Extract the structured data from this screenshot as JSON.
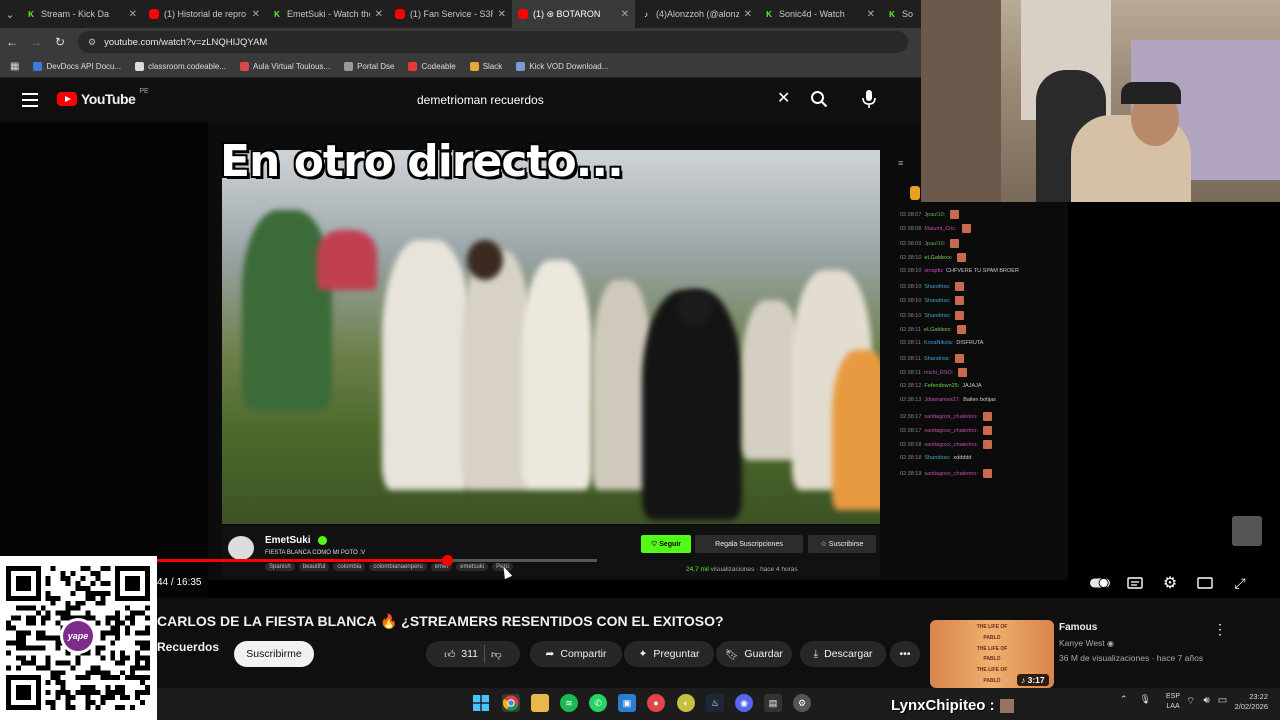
{
  "browser": {
    "tabs": [
      {
        "label": "Stream - Kick Da",
        "icon": "kick-icon",
        "active": false
      },
      {
        "label": "(1) Historial de repro",
        "icon": "youtube-icon",
        "active": false
      },
      {
        "label": "EmetSuki - Watch the",
        "icon": "kick-icon",
        "active": false
      },
      {
        "label": "(1) Fan Service - S3RL",
        "icon": "youtube-icon",
        "active": false
      },
      {
        "label": "(1) ⊛ BOTARON",
        "icon": "youtube-icon",
        "active": true
      },
      {
        "label": "(4)Alonzzoh (@alonz",
        "icon": "tiktok-icon",
        "active": false
      },
      {
        "label": "Sonic4d - Watch",
        "icon": "kick-icon",
        "active": false
      },
      {
        "label": "So",
        "icon": "kick-icon",
        "active": false
      }
    ],
    "url": "youtube.com/watch?v=zLNQHIJQYAM",
    "bookmarks": [
      {
        "label": "DevDocs API Docu...",
        "color": "#3a7bd5"
      },
      {
        "label": "classroom.codeable...",
        "color": "#dddddd"
      },
      {
        "label": "Aula Virtual Toulous...",
        "color": "#d84a4a"
      },
      {
        "label": "Portal Dse",
        "color": "#999999"
      },
      {
        "label": "Codeable",
        "color": "#e53935"
      },
      {
        "label": "Slack",
        "color": "#e8a53a"
      },
      {
        "label": "Kick VOD Download...",
        "color": "#7a9cd6"
      }
    ]
  },
  "youtube": {
    "logo": "YouTube",
    "region": "PE",
    "search_query": "demetrioman recuerdos"
  },
  "video": {
    "caption": "En otro directo...",
    "stream": {
      "streamer": "EmetSuki",
      "title": "FIESTA BLANCA COMO MI POTO :V",
      "follow_label": "♡ Seguir",
      "gift_label": "Regala Suscripciones",
      "subscribe_label": "☆ Suscribirse",
      "tags": [
        "Spanish",
        "beautiful",
        "colombia",
        "colombianaenperu",
        "emet",
        "emetsuki",
        "Perú"
      ],
      "views_count": "24,7 mil",
      "views_rest": " visualizaciones · hace 4 horas"
    },
    "chat": [
      {
        "time": "02:38:07",
        "user": "Jpaul10:",
        "color": "#6aa84f",
        "text": "",
        "emote": true
      },
      {
        "time": "02:38:08",
        "user": "Maiumi_Cric:",
        "color": "#c64fb0",
        "text": "",
        "emote": true
      },
      {
        "time": "02:38:09",
        "user": "Jpaul10:",
        "color": "#6aa84f",
        "text": "",
        "emote": true
      },
      {
        "time": "02:38:10",
        "user": "eLGablexx:",
        "color": "#7ec850",
        "text": "",
        "emote": true
      },
      {
        "time": "02:38:10",
        "user": "sinaptiz",
        "color": "#c64fb0",
        "text": "CHFVERE TU SPAM BROER",
        "emote": false
      },
      {
        "time": "02:38:10",
        "user": "Shandriss:",
        "color": "#3da5d9",
        "text": "",
        "emote": true
      },
      {
        "time": "02:38:10",
        "user": "Shandriss:",
        "color": "#3da5d9",
        "text": "",
        "emote": true
      },
      {
        "time": "02:38:10",
        "user": "Shandriss:",
        "color": "#3da5d9",
        "text": "",
        "emote": true
      },
      {
        "time": "02:38:11",
        "user": "eLGablexx:",
        "color": "#7ec850",
        "text": "",
        "emote": true
      },
      {
        "time": "02:38:11",
        "user": "KovaNikola:",
        "color": "#3da5d9",
        "text": "DISFRUTA",
        "emote": false
      },
      {
        "time": "02:38:11",
        "user": "Shandriss:",
        "color": "#3da5d9",
        "text": "",
        "emote": true
      },
      {
        "time": "02:38:11",
        "user": "michi_RSO:",
        "color": "#c64fb0",
        "text": "",
        "emote": true
      },
      {
        "time": "02:38:12",
        "user": "Fefendown25:",
        "color": "#7ec850",
        "text": "JAJAJA",
        "emote": false
      },
      {
        "time": "02:38:13",
        "user": "Jdiamantes27:",
        "color": "#c64fb0",
        "text": "Bailen botijas",
        "emote": false
      },
      {
        "time": "02:38:17",
        "user": "santiagoxx_chaterino:",
        "color": "#c64fb0",
        "text": "",
        "emote": true
      },
      {
        "time": "02:38:17",
        "user": "santiagoxx_chaterino:",
        "color": "#c64fb0",
        "text": "",
        "emote": true
      },
      {
        "time": "02:38:18",
        "user": "santiagoxx_chaterino:",
        "color": "#c64fb0",
        "text": "",
        "emote": true
      },
      {
        "time": "02:38:18",
        "user": "Shandriss:",
        "color": "#3da5d9",
        "text": "xddddd",
        "emote": false
      },
      {
        "time": "02:38:19",
        "user": "santiagoxx_chaterino:",
        "color": "#c64fb0",
        "text": "",
        "emote": true
      }
    ],
    "time_current": "44",
    "time_total": "16:35",
    "progress": 0.659
  },
  "details": {
    "title": "CARLOS DE LA FIESTA BLANCA 🔥 ¿STREAMERS RESENTIDOS CON EL EXITOSO?",
    "channel": "Recuerdos",
    "subscribe_label": "Suscribirme",
    "likes": "311",
    "share_label": "Compartir",
    "ask_label": "Preguntar",
    "save_label": "Guardar",
    "download_label": "Descargar"
  },
  "recommended": {
    "title": "Famous",
    "channel": "Kanye West",
    "meta": "36 M de visualizaciones · hace 7 años",
    "duration": "3:17",
    "thumb_lines": [
      "THE LIFE OF",
      "PABLO",
      "THE LIFE OF",
      "PABLO",
      "THE LIFE OF",
      "PABLO"
    ]
  },
  "overlay": {
    "qr_logo": "yape",
    "chat_user": "LynxChipiteo :"
  },
  "taskbar": {
    "lang_line1": "ESP",
    "lang_line2": "LAA",
    "time": "23:22",
    "date": "2/02/2026"
  },
  "colors": {
    "youtube_red": "#ff0000",
    "kick_green": "#53fc18",
    "background": "#0f0f0f"
  }
}
